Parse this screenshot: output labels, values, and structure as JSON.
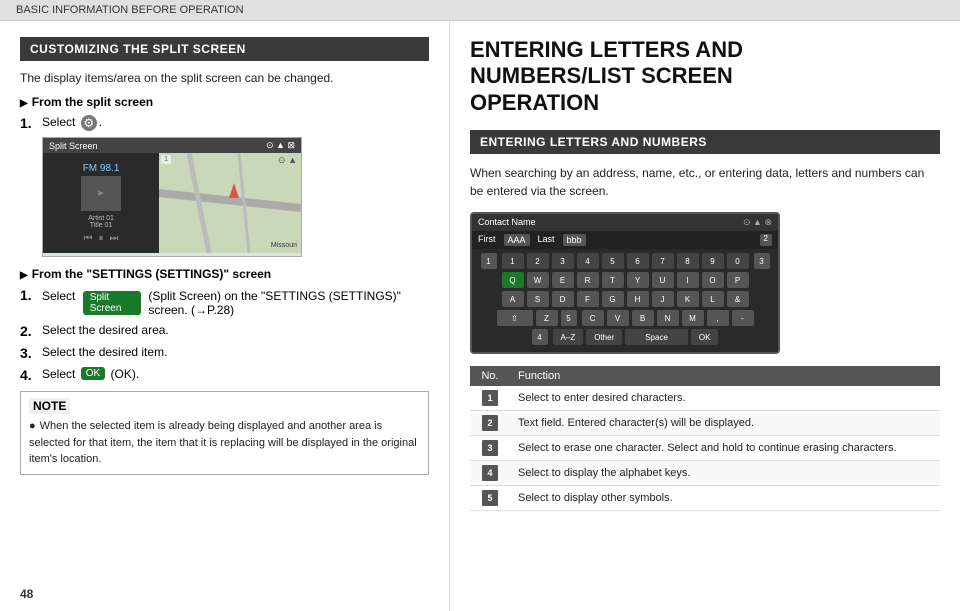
{
  "topbar": {
    "label": "BASIC INFORMATION BEFORE OPERATION"
  },
  "left": {
    "section_title": "CUSTOMIZING THE SPLIT SCREEN",
    "intro": "The display items/area on the split screen can be changed.",
    "from_split_screen": "From the split screen",
    "step1_label": "Select",
    "step1_icon": "⚙",
    "from_settings_screen": "From the \"SETTINGS (SETTINGS)\" screen",
    "settings_step1": "Select",
    "settings_step1_btn": "Split Screen",
    "settings_step1_rest": "(Split Screen) on the \"SETTINGS (SETTINGS)\" screen. (→P.28)",
    "settings_step2": "Select the desired area.",
    "settings_step3": "Select the desired item.",
    "settings_step4": "Select",
    "settings_step4_btn": "OK",
    "settings_step4_rest": "(OK).",
    "note_title": "NOTE",
    "note_text": "When the selected item is already being displayed and another area is selected for that item, the item that it is replacing will be displayed in the original item's location.",
    "split_screen_header": "Split Screen",
    "split_screen_radio": "FM 98.1",
    "split_screen_artist": "Artist 01",
    "split_screen_title": "Title 01",
    "split_screen_map_label": "Missouri",
    "page_number": "48"
  },
  "right": {
    "big_title_line1": "ENTERING LETTERS AND",
    "big_title_line2": "NUMBERS/LIST SCREEN",
    "big_title_line3": "OPERATION",
    "section_title": "ENTERING LETTERS AND NUMBERS",
    "intro": "When searching by an address, name, etc., or entering data, letters and numbers can be entered via the screen.",
    "contact_screen": {
      "header_label": "Contact Name",
      "first_label": "First",
      "first_value": "AAA",
      "last_label": "Last",
      "last_value": "bbb",
      "num_row": [
        "1",
        "2",
        "3",
        "4",
        "5",
        "6",
        "7",
        "8",
        "9",
        "0"
      ],
      "row_q": [
        "Q",
        "W",
        "E",
        "R",
        "T",
        "Y",
        "U",
        "I",
        "O",
        "P"
      ],
      "row_a": [
        "A",
        "S",
        "D",
        "F",
        "G",
        "H",
        "J",
        "K",
        "L",
        "&"
      ],
      "row_z": [
        "Z",
        "C",
        "V",
        "B",
        "N",
        "M",
        ",",
        "-"
      ],
      "bottom": [
        "A–Z",
        "Other",
        "Space",
        "OK"
      ]
    },
    "table": {
      "col_no": "No.",
      "col_func": "Function",
      "rows": [
        {
          "no": "1",
          "func": "Select to enter desired characters."
        },
        {
          "no": "2",
          "func": "Text field. Entered character(s) will be displayed."
        },
        {
          "no": "3",
          "func": "Select to erase one character. Select and hold to continue erasing characters."
        },
        {
          "no": "4",
          "func": "Select to display the alphabet keys."
        },
        {
          "no": "5",
          "func": "Select to display other symbols."
        }
      ]
    }
  }
}
